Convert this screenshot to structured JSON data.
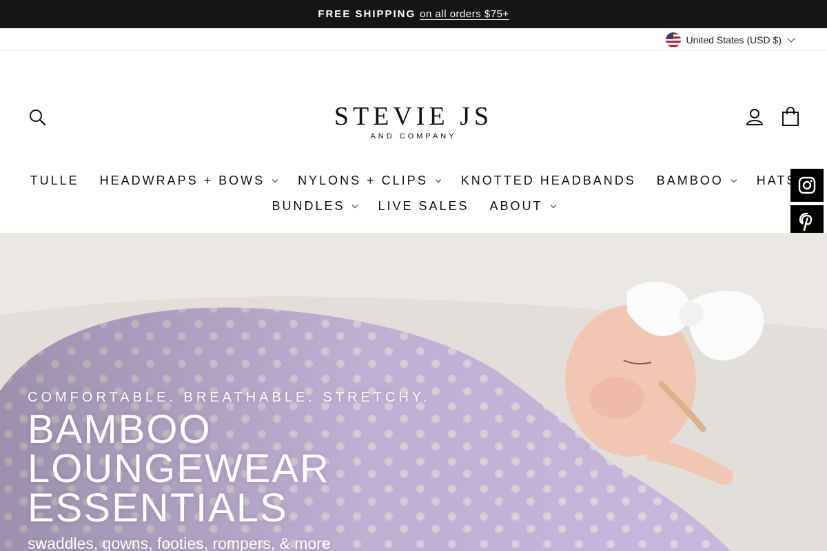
{
  "announcement": {
    "strong": "FREE SHIPPING",
    "link": "on all orders $75+"
  },
  "currency": {
    "label": "United States (USD $)",
    "flag_icon": "us-flag-icon"
  },
  "header": {
    "logo_main": "STEVIE JS",
    "logo_sub": "AND COMPANY",
    "icons": [
      "search-icon",
      "user-icon",
      "shopping-bag-icon"
    ]
  },
  "nav": {
    "row1": [
      {
        "label": "TULLE",
        "dropdown": false
      },
      {
        "label": "HEADWRAPS + BOWS",
        "dropdown": true
      },
      {
        "label": "NYLONS + CLIPS",
        "dropdown": true
      },
      {
        "label": "KNOTTED HEADBANDS",
        "dropdown": false
      },
      {
        "label": "BAMBOO",
        "dropdown": true
      },
      {
        "label": "HATS",
        "dropdown": false
      }
    ],
    "row2": [
      {
        "label": "BUNDLES",
        "dropdown": true
      },
      {
        "label": "LIVE SALES",
        "dropdown": false
      },
      {
        "label": "ABOUT",
        "dropdown": true
      }
    ]
  },
  "social": [
    "instagram-icon",
    "pinterest-icon",
    "facebook-icon"
  ],
  "hero": {
    "kicker": "COMFORTABLE. BREATHABLE. STRETCHY.",
    "title": "BAMBOO LOUNGEWEAR ESSENTIALS",
    "subtitle": "swaddles, gowns, footies, rompers, & more"
  },
  "colors": {
    "announcement_bg": "#151515",
    "swaddle": "#c7b6dc",
    "social_bg": "#000000"
  }
}
